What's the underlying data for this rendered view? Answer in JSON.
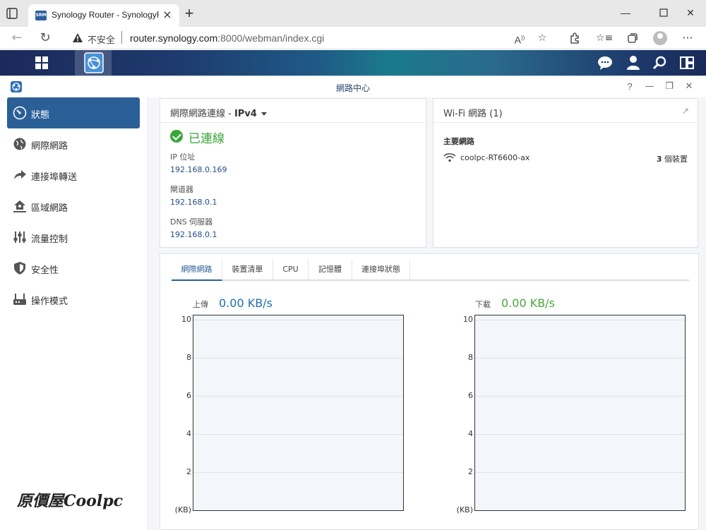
{
  "browser": {
    "tab_title": "Synology Router - SynologyRouter",
    "tab_icon": "SRM",
    "insecure_label": "不安全",
    "url_host": "router.synology.com",
    "url_path": ":8000/webman/index.cgi"
  },
  "app": {
    "title": "網路中心",
    "accent": "#2a5f98"
  },
  "sidebar": {
    "items": [
      {
        "label": "狀態",
        "icon": "speedometer-icon",
        "active": true
      },
      {
        "label": "網際網路",
        "icon": "globe-icon"
      },
      {
        "label": "連接埠轉送",
        "icon": "forward-arrow-icon"
      },
      {
        "label": "區域網路",
        "icon": "home-network-icon"
      },
      {
        "label": "流量控制",
        "icon": "sliders-icon"
      },
      {
        "label": "安全性",
        "icon": "shield-icon"
      },
      {
        "label": "操作模式",
        "icon": "router-icon"
      }
    ]
  },
  "internet": {
    "title_prefix": "網際網路連線 - ",
    "title_mode": "IPv4",
    "status": "已連線",
    "ip_label": "IP 位址",
    "ip_value": "192.168.0.169",
    "gateway_label": "閘道器",
    "gateway_value": "192.168.0.1",
    "dns_label": "DNS 伺服器",
    "dns_value": "192.168.0.1"
  },
  "wifi": {
    "title": "Wi-Fi 網路 (1)",
    "section": "主要網路",
    "ssid": "coolpc-RT6600-ax",
    "device_count": "3",
    "device_unit": " 個裝置"
  },
  "monitor": {
    "tabs": [
      "網際網路",
      "裝置清單",
      "CPU",
      "記憶體",
      "連接埠狀態"
    ],
    "upload_label": "上傳",
    "upload_value": "0.00 KB/s",
    "upload_color": "#1f6fb0",
    "download_label": "下載",
    "download_value": "0.00 KB/s",
    "download_color": "#4aa63a",
    "y_ticks": [
      "10",
      "8",
      "6",
      "4",
      "2"
    ],
    "y_unit": "(KB)"
  },
  "watermark": "原價屋Coolpc"
}
